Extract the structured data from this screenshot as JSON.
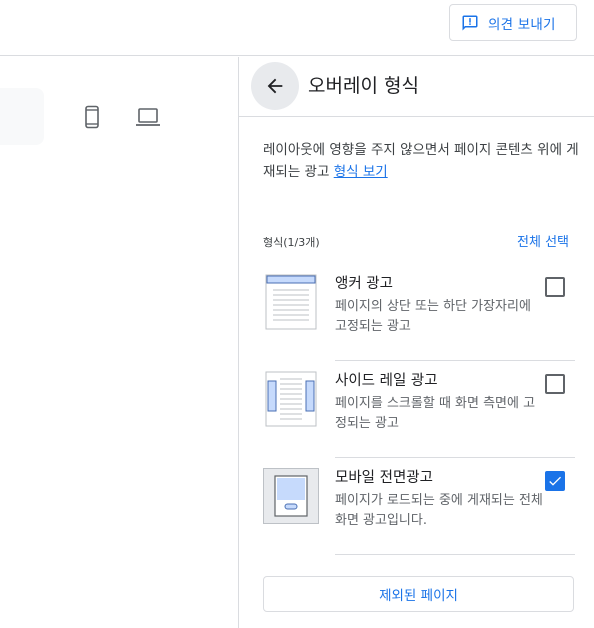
{
  "topbar": {
    "feedback_label": "의견 보내기",
    "feedback_icon": "feedback-icon"
  },
  "preview": {
    "devices": [
      {
        "name": "mobile",
        "icon": "smartphone-icon"
      },
      {
        "name": "desktop",
        "icon": "laptop-icon"
      }
    ]
  },
  "panel": {
    "back_icon": "arrow-back-icon",
    "title": "오버레이 형식",
    "description": "레이아웃에 영향을 주지 않으면서 페이지 콘텐츠 위에 게재되는 광고",
    "description_link": "형식 보기",
    "format_count": "형식(1/3개)",
    "select_all": "전체 선택",
    "formats": [
      {
        "name": "앵커 광고",
        "description": "페이지의 상단 또는 하단 가장자리에 고정되는 광고",
        "checked": false,
        "icon": "anchor-ad-thumbnail"
      },
      {
        "name": "사이드 레일 광고",
        "description": "페이지를 스크롤할 때 화면 측면에 고정되는 광고",
        "checked": false,
        "icon": "side-rail-ad-thumbnail"
      },
      {
        "name": "모바일 전면광고",
        "description": "페이지가 로드되는 중에 게재되는 전체 화면 광고입니다.",
        "checked": true,
        "icon": "mobile-vignette-thumbnail"
      }
    ],
    "excluded_pages": "제외된 페이지"
  },
  "colors": {
    "accent": "#1a73e8",
    "border": "#dadce0",
    "text": "#202124",
    "secondary_text": "#5f6368",
    "back_bg": "#e8eaed"
  }
}
